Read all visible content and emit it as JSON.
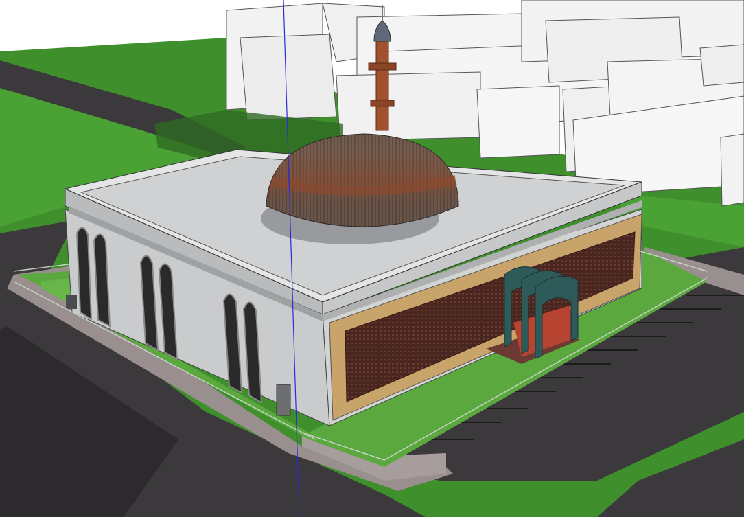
{
  "viewport": {
    "description_visible_text": "",
    "colors": {
      "sky": "#ffffff",
      "grass": "#3f8f2c",
      "grass_light": "#4aa235",
      "asphalt": "#3b393b",
      "asphalt_dark": "#2c2a2c",
      "sidewalk": "#9a8f8f",
      "roof": "#cfd1d3",
      "wall": "#c9cbcc",
      "wall_shade": "#b3b5b7",
      "dome_brown": "#7a5a45",
      "dome_band": "#8b4a2f",
      "minaret": "#a0512e",
      "minaret_cap": "#5f6a78",
      "facade_wood": "#c9a46a",
      "facade_brick": "#4a2621",
      "portal_teal": "#2f5a5a",
      "stairs": "#b64430",
      "buildings": "#f2f2f2",
      "axis_blue": "#2b2bd9"
    }
  }
}
